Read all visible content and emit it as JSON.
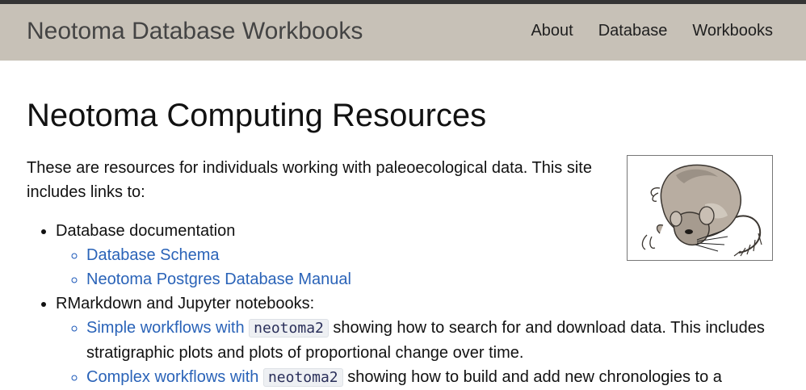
{
  "header": {
    "title": "Neotoma Database Workbooks",
    "nav": [
      "About",
      "Database",
      "Workbooks"
    ]
  },
  "main": {
    "heading": "Neotoma Computing Resources",
    "intro": "These are resources for individuals working with paleoecological data. This site includes links to:",
    "image_alt": "illustration of a Neotoma packrat",
    "list": [
      {
        "label": "Database documentation",
        "children": [
          {
            "link": "Database Schema"
          },
          {
            "link": "Neotoma Postgres Database Manual"
          }
        ]
      },
      {
        "label": "RMarkdown and Jupyter notebooks:",
        "children": [
          {
            "link": "Simple workflows with",
            "code": "neotoma2",
            "rest": " showing how to search for and download data. This includes stratigraphic plots and plots of proportional change over time."
          },
          {
            "link": "Complex workflows with",
            "code": "neotoma2",
            "rest": " showing how to build and add new chronologies to a"
          }
        ]
      }
    ]
  },
  "colors": {
    "header_bg": "#c7c1b7",
    "header_border": "#343434",
    "link": "#2a63b8"
  }
}
